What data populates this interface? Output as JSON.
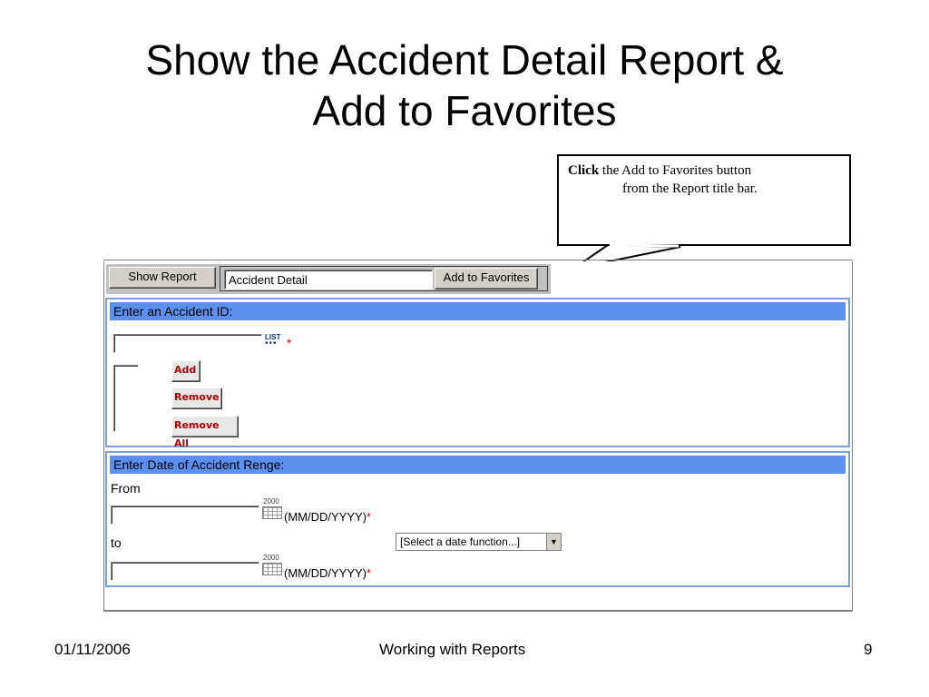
{
  "slide": {
    "title_line1": "Show the Accident Detail Report &",
    "title_line2": "Add to Favorites"
  },
  "callout": {
    "bold_word": "Click",
    "text_line1": " the Add to Favorites button",
    "text_line2": "from the Report title bar."
  },
  "toolbar": {
    "show_report_label": "Show Report",
    "report_name_value": "Accident Detail",
    "add_to_favorites_label": "Add to Favorites"
  },
  "accident_section": {
    "header": "Enter an Accident ID:",
    "id_input_value": "",
    "list_icon_label": "LIST",
    "required_marker": "*",
    "add_label": "Add",
    "remove_label": "Remove",
    "remove_all_label": "Remove All"
  },
  "date_section": {
    "header": "Enter Date of Accident Renge:",
    "from_label": "From",
    "to_label": "to",
    "date_format_hint": "(MM/DD/YYYY)",
    "required_marker": "*",
    "calendar_year": "2000",
    "from_value": "",
    "to_value": "",
    "date_function_selected": "[Select a date function...]",
    "dropdown_arrow": "▼"
  },
  "footer": {
    "date": "01/11/2006",
    "center": "Working with Reports",
    "page_number": "9"
  }
}
